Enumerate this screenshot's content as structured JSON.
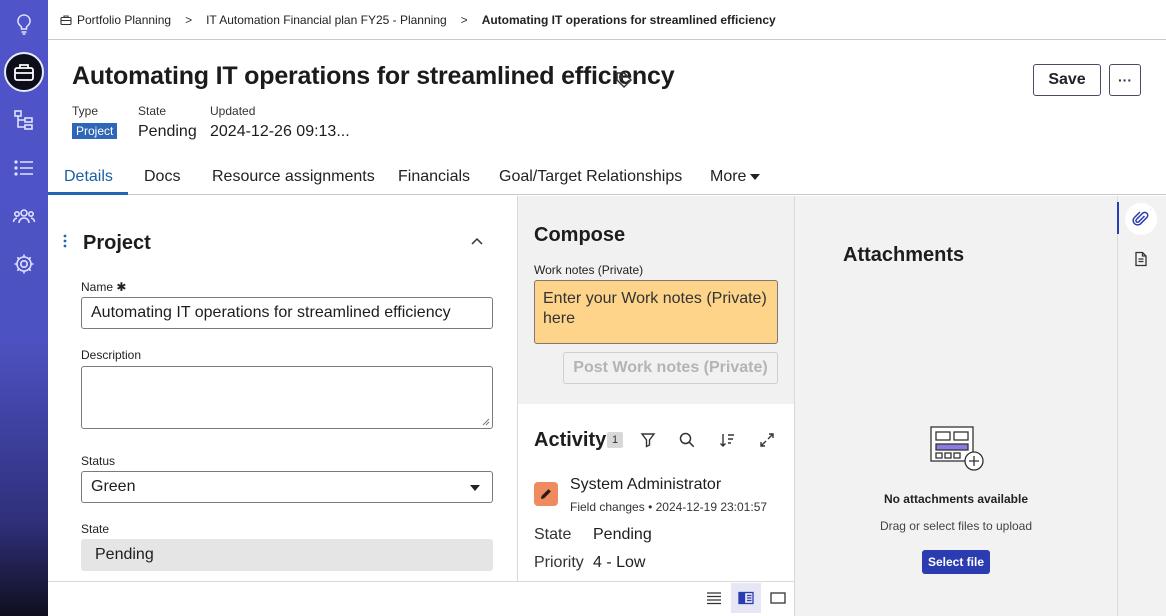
{
  "breadcrumbs": [
    {
      "label": "Portfolio Planning"
    },
    {
      "label": "IT Automation Financial plan FY25 - Planning"
    },
    {
      "label": "Automating IT operations for streamlined efficiency"
    }
  ],
  "header": {
    "title": "Automating IT operations for streamlined efficiency",
    "save_label": "Save",
    "more_label": "···",
    "type_label": "Type",
    "type_value": "Project",
    "state_label": "State",
    "state_value": "Pending",
    "updated_label": "Updated",
    "updated_value": "2024-12-26 09:13..."
  },
  "tabs": [
    {
      "label": "Details",
      "active": true
    },
    {
      "label": "Docs"
    },
    {
      "label": "Resource assignments"
    },
    {
      "label": "Financials"
    },
    {
      "label": "Goal/Target Relationships"
    },
    {
      "label": "More"
    }
  ],
  "form": {
    "section_title": "Project",
    "name_label": "Name",
    "name_required": "✱",
    "name_value": "Automating IT operations for streamlined efficiency",
    "description_label": "Description",
    "description_value": "",
    "status_label": "Status",
    "status_value": "Green",
    "state_label": "State",
    "state_value": "Pending"
  },
  "compose": {
    "title": "Compose",
    "work_notes_label": "Work notes (Private)",
    "work_notes_placeholder": "Enter your Work notes (Private) here",
    "post_label": "Post Work notes (Private)"
  },
  "activity": {
    "title": "Activity",
    "count": "1",
    "entries": [
      {
        "user": "System Administrator",
        "type": "Field changes",
        "timestamp": "2024-12-19 23:01:57",
        "changes": [
          {
            "field": "State",
            "value": "Pending"
          },
          {
            "field": "Priority",
            "value": "4 - Low"
          }
        ]
      }
    ]
  },
  "attachments": {
    "title": "Attachments",
    "empty_title": "No attachments available",
    "empty_hint": "Drag or select files to upload",
    "select_label": "Select file"
  },
  "colors": {
    "rail": "#4f55c9",
    "accent": "#2166b2",
    "badge": "#2f67b8",
    "work_notes_bg": "#fdd48a",
    "select_file_bg": "#2a3cb0"
  },
  "icons": {
    "rail": [
      "lightbulb-icon",
      "briefcase-icon",
      "hierarchy-icon",
      "list-icon",
      "team-icon",
      "gear-icon"
    ],
    "side": [
      "paperclip-icon",
      "document-icon"
    ],
    "footer": [
      "compact-list-icon",
      "split-view-icon",
      "single-view-icon"
    ]
  }
}
